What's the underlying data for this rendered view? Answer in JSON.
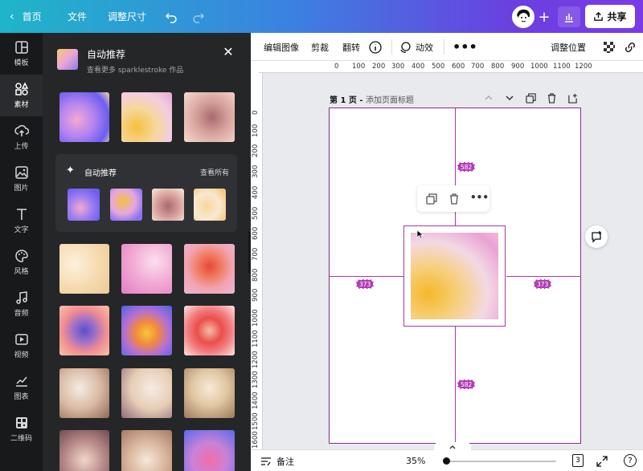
{
  "topbar": {
    "home_label": "首页",
    "file_label": "文件",
    "resize_label": "调整尺寸",
    "share_label": "共享"
  },
  "rail": {
    "items": [
      {
        "label": "模板"
      },
      {
        "label": "素材"
      },
      {
        "label": "上传"
      },
      {
        "label": "图片"
      },
      {
        "label": "文字"
      },
      {
        "label": "风格"
      },
      {
        "label": "音频"
      },
      {
        "label": "视频"
      },
      {
        "label": "图表"
      },
      {
        "label": "二维码"
      }
    ]
  },
  "panel": {
    "title": "自动推荐",
    "subtitle": "查看更多 sparklestroke 作品",
    "rec_title": "自动推荐",
    "rec_see_all": "查看所有"
  },
  "toolbar": {
    "edit_image": "编辑图像",
    "crop": "剪裁",
    "flip": "翻转",
    "animate": "动效",
    "position": "调整位置"
  },
  "ruler_h": [
    "0",
    "100",
    "200",
    "300",
    "400",
    "500",
    "600",
    "700",
    "800",
    "900",
    "1000",
    "1100",
    "1200"
  ],
  "ruler_v": [
    "0",
    "100",
    "200",
    "300",
    "400",
    "500",
    "600",
    "700",
    "800",
    "900",
    "1000",
    "1100",
    "1200",
    "1300",
    "1400",
    "1500",
    "1600"
  ],
  "page": {
    "label": "第 1 页 - ",
    "title_placeholder": "添加页面标题"
  },
  "measures": {
    "top": "582",
    "bottom": "582",
    "left": "373",
    "right": "373"
  },
  "bottom": {
    "notes": "备注",
    "zoom": "35%",
    "page_count": "3",
    "help": "?"
  },
  "colors": {
    "accent_purple": "#a43aa4",
    "topbar_start": "#1fb5c9",
    "topbar_end": "#7a3be6"
  }
}
